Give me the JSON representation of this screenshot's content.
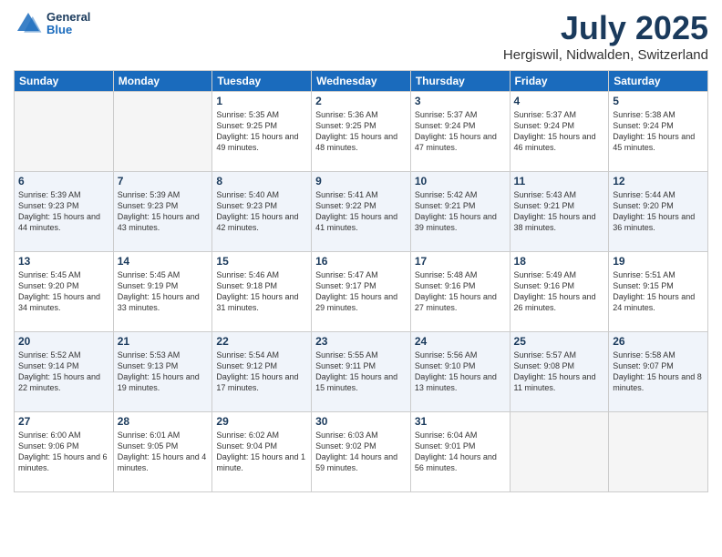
{
  "header": {
    "logo_general": "General",
    "logo_blue": "Blue",
    "month": "July 2025",
    "location": "Hergiswil, Nidwalden, Switzerland"
  },
  "days_of_week": [
    "Sunday",
    "Monday",
    "Tuesday",
    "Wednesday",
    "Thursday",
    "Friday",
    "Saturday"
  ],
  "weeks": [
    [
      {
        "day": "",
        "empty": true
      },
      {
        "day": "",
        "empty": true
      },
      {
        "day": "1",
        "sunrise": "Sunrise: 5:35 AM",
        "sunset": "Sunset: 9:25 PM",
        "daylight": "Daylight: 15 hours and 49 minutes."
      },
      {
        "day": "2",
        "sunrise": "Sunrise: 5:36 AM",
        "sunset": "Sunset: 9:25 PM",
        "daylight": "Daylight: 15 hours and 48 minutes."
      },
      {
        "day": "3",
        "sunrise": "Sunrise: 5:37 AM",
        "sunset": "Sunset: 9:24 PM",
        "daylight": "Daylight: 15 hours and 47 minutes."
      },
      {
        "day": "4",
        "sunrise": "Sunrise: 5:37 AM",
        "sunset": "Sunset: 9:24 PM",
        "daylight": "Daylight: 15 hours and 46 minutes."
      },
      {
        "day": "5",
        "sunrise": "Sunrise: 5:38 AM",
        "sunset": "Sunset: 9:24 PM",
        "daylight": "Daylight: 15 hours and 45 minutes."
      }
    ],
    [
      {
        "day": "6",
        "sunrise": "Sunrise: 5:39 AM",
        "sunset": "Sunset: 9:23 PM",
        "daylight": "Daylight: 15 hours and 44 minutes."
      },
      {
        "day": "7",
        "sunrise": "Sunrise: 5:39 AM",
        "sunset": "Sunset: 9:23 PM",
        "daylight": "Daylight: 15 hours and 43 minutes."
      },
      {
        "day": "8",
        "sunrise": "Sunrise: 5:40 AM",
        "sunset": "Sunset: 9:23 PM",
        "daylight": "Daylight: 15 hours and 42 minutes."
      },
      {
        "day": "9",
        "sunrise": "Sunrise: 5:41 AM",
        "sunset": "Sunset: 9:22 PM",
        "daylight": "Daylight: 15 hours and 41 minutes."
      },
      {
        "day": "10",
        "sunrise": "Sunrise: 5:42 AM",
        "sunset": "Sunset: 9:21 PM",
        "daylight": "Daylight: 15 hours and 39 minutes."
      },
      {
        "day": "11",
        "sunrise": "Sunrise: 5:43 AM",
        "sunset": "Sunset: 9:21 PM",
        "daylight": "Daylight: 15 hours and 38 minutes."
      },
      {
        "day": "12",
        "sunrise": "Sunrise: 5:44 AM",
        "sunset": "Sunset: 9:20 PM",
        "daylight": "Daylight: 15 hours and 36 minutes."
      }
    ],
    [
      {
        "day": "13",
        "sunrise": "Sunrise: 5:45 AM",
        "sunset": "Sunset: 9:20 PM",
        "daylight": "Daylight: 15 hours and 34 minutes."
      },
      {
        "day": "14",
        "sunrise": "Sunrise: 5:45 AM",
        "sunset": "Sunset: 9:19 PM",
        "daylight": "Daylight: 15 hours and 33 minutes."
      },
      {
        "day": "15",
        "sunrise": "Sunrise: 5:46 AM",
        "sunset": "Sunset: 9:18 PM",
        "daylight": "Daylight: 15 hours and 31 minutes."
      },
      {
        "day": "16",
        "sunrise": "Sunrise: 5:47 AM",
        "sunset": "Sunset: 9:17 PM",
        "daylight": "Daylight: 15 hours and 29 minutes."
      },
      {
        "day": "17",
        "sunrise": "Sunrise: 5:48 AM",
        "sunset": "Sunset: 9:16 PM",
        "daylight": "Daylight: 15 hours and 27 minutes."
      },
      {
        "day": "18",
        "sunrise": "Sunrise: 5:49 AM",
        "sunset": "Sunset: 9:16 PM",
        "daylight": "Daylight: 15 hours and 26 minutes."
      },
      {
        "day": "19",
        "sunrise": "Sunrise: 5:51 AM",
        "sunset": "Sunset: 9:15 PM",
        "daylight": "Daylight: 15 hours and 24 minutes."
      }
    ],
    [
      {
        "day": "20",
        "sunrise": "Sunrise: 5:52 AM",
        "sunset": "Sunset: 9:14 PM",
        "daylight": "Daylight: 15 hours and 22 minutes."
      },
      {
        "day": "21",
        "sunrise": "Sunrise: 5:53 AM",
        "sunset": "Sunset: 9:13 PM",
        "daylight": "Daylight: 15 hours and 19 minutes."
      },
      {
        "day": "22",
        "sunrise": "Sunrise: 5:54 AM",
        "sunset": "Sunset: 9:12 PM",
        "daylight": "Daylight: 15 hours and 17 minutes."
      },
      {
        "day": "23",
        "sunrise": "Sunrise: 5:55 AM",
        "sunset": "Sunset: 9:11 PM",
        "daylight": "Daylight: 15 hours and 15 minutes."
      },
      {
        "day": "24",
        "sunrise": "Sunrise: 5:56 AM",
        "sunset": "Sunset: 9:10 PM",
        "daylight": "Daylight: 15 hours and 13 minutes."
      },
      {
        "day": "25",
        "sunrise": "Sunrise: 5:57 AM",
        "sunset": "Sunset: 9:08 PM",
        "daylight": "Daylight: 15 hours and 11 minutes."
      },
      {
        "day": "26",
        "sunrise": "Sunrise: 5:58 AM",
        "sunset": "Sunset: 9:07 PM",
        "daylight": "Daylight: 15 hours and 8 minutes."
      }
    ],
    [
      {
        "day": "27",
        "sunrise": "Sunrise: 6:00 AM",
        "sunset": "Sunset: 9:06 PM",
        "daylight": "Daylight: 15 hours and 6 minutes."
      },
      {
        "day": "28",
        "sunrise": "Sunrise: 6:01 AM",
        "sunset": "Sunset: 9:05 PM",
        "daylight": "Daylight: 15 hours and 4 minutes."
      },
      {
        "day": "29",
        "sunrise": "Sunrise: 6:02 AM",
        "sunset": "Sunset: 9:04 PM",
        "daylight": "Daylight: 15 hours and 1 minute."
      },
      {
        "day": "30",
        "sunrise": "Sunrise: 6:03 AM",
        "sunset": "Sunset: 9:02 PM",
        "daylight": "Daylight: 14 hours and 59 minutes."
      },
      {
        "day": "31",
        "sunrise": "Sunrise: 6:04 AM",
        "sunset": "Sunset: 9:01 PM",
        "daylight": "Daylight: 14 hours and 56 minutes."
      },
      {
        "day": "",
        "empty": true
      },
      {
        "day": "",
        "empty": true
      }
    ]
  ]
}
